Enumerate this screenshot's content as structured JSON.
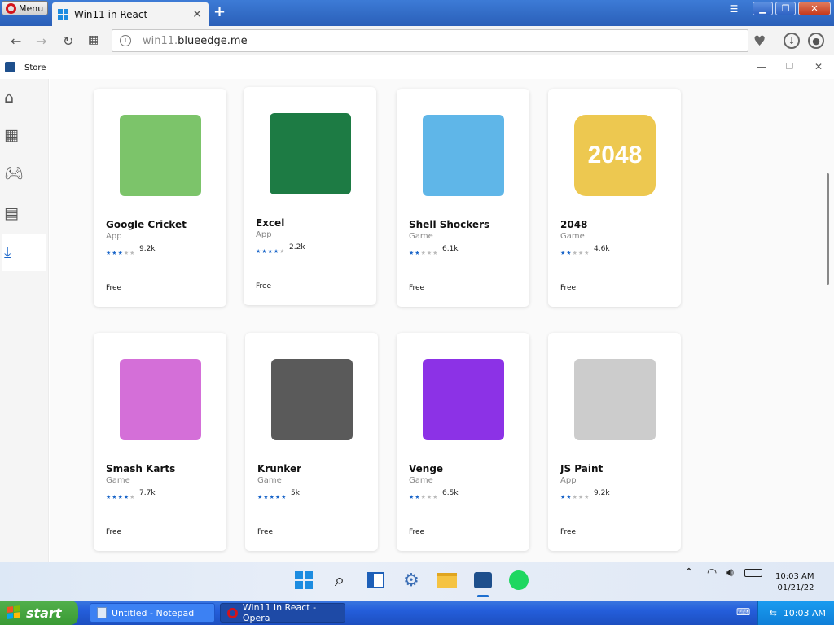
{
  "browser": {
    "menu_label": "Menu",
    "tab_title": "Win11 in React",
    "url_prefix": "win11.",
    "url_host": "blueedge.me"
  },
  "store": {
    "window_title": "Store",
    "nav": [
      "home",
      "apps",
      "games",
      "movies",
      "downloads"
    ],
    "apps": [
      {
        "name": "Google Cricket",
        "kind": "App",
        "stars": 3,
        "count": "9.2k",
        "price": "Free",
        "accent": "#7cc46a"
      },
      {
        "name": "Excel",
        "kind": "App",
        "stars": 4,
        "count": "2.2k",
        "price": "Free",
        "accent": "#1d7b44"
      },
      {
        "name": "Shell Shockers",
        "kind": "Game",
        "stars": 2,
        "count": "6.1k",
        "price": "Free",
        "accent": "#5fb6e8"
      },
      {
        "name": "2048",
        "kind": "Game",
        "stars": 2,
        "count": "4.6k",
        "price": "Free",
        "accent": "#edc850",
        "logo_text": "2048"
      },
      {
        "name": "Smash Karts",
        "kind": "Game",
        "stars": 4,
        "count": "7.7k",
        "price": "Free",
        "accent": "#d46fd8"
      },
      {
        "name": "Krunker",
        "kind": "Game",
        "stars": 5,
        "count": "5k",
        "price": "Free",
        "accent": "#5a5a5a"
      },
      {
        "name": "Venge",
        "kind": "Game",
        "stars": 2,
        "count": "6.5k",
        "price": "Free",
        "accent": "#8c32e6"
      },
      {
        "name": "JS Paint",
        "kind": "App",
        "stars": 2,
        "count": "9.2k",
        "price": "Free",
        "accent": "#cccccc"
      }
    ]
  },
  "win11_taskbar": {
    "time": "10:03 AM",
    "date": "01/21/22"
  },
  "xp_taskbar": {
    "start_label": "start",
    "tasks": [
      "Untitled - Notepad",
      "Win11 in React - Opera"
    ],
    "time": "10:03 AM"
  }
}
